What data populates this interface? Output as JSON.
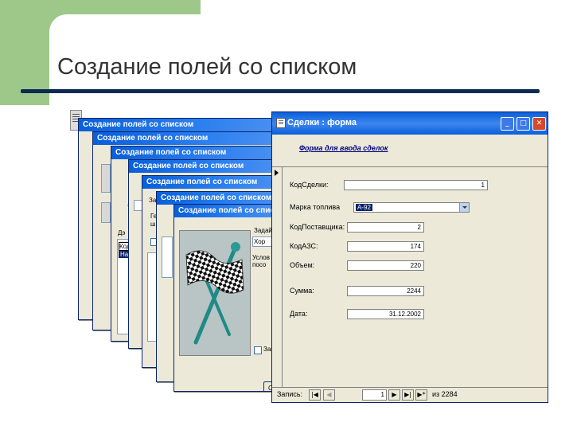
{
  "slide": {
    "title": "Создание полей со списком"
  },
  "wizard": {
    "title": "Создание полей со списком",
    "fragments": {
      "w3_line": "Т",
      "w4_zaz": "За",
      "w4_ge": "Ге",
      "w4_sh": "ш",
      "w3_dz": "Дэ",
      "w3_kod": "Код",
      "w3_na": "На",
      "w7_zadai": "Задай",
      "w7_hor": "Хор",
      "w7_uslo": "Услов",
      "w7_poso": "посо",
      "w7_zap": "Зап",
      "w7_s": "С"
    }
  },
  "form": {
    "title": "Сделки : форма",
    "header_label": "Форма для ввода сделок",
    "fields": [
      {
        "label": "КодСделки:",
        "value": "1"
      },
      {
        "label": "Марка топлива",
        "value": "А-92"
      },
      {
        "label": "КодПоставщика:",
        "value": "2"
      },
      {
        "label": "КодАЗС:",
        "value": "174"
      },
      {
        "label": "Объем:",
        "value": "220"
      },
      {
        "label": "Сумма:",
        "value": "2244"
      },
      {
        "label": "Дата:",
        "value": "31.12.2002"
      }
    ],
    "nav": {
      "label": "Запись:",
      "current": "1",
      "of_text": "из  2284"
    }
  },
  "colors": {
    "accent_green": "#9dc88a",
    "title_rule": "#0b2b52",
    "xp_titlebar": "#0a5fd9",
    "window_bg": "#ece9d8"
  }
}
